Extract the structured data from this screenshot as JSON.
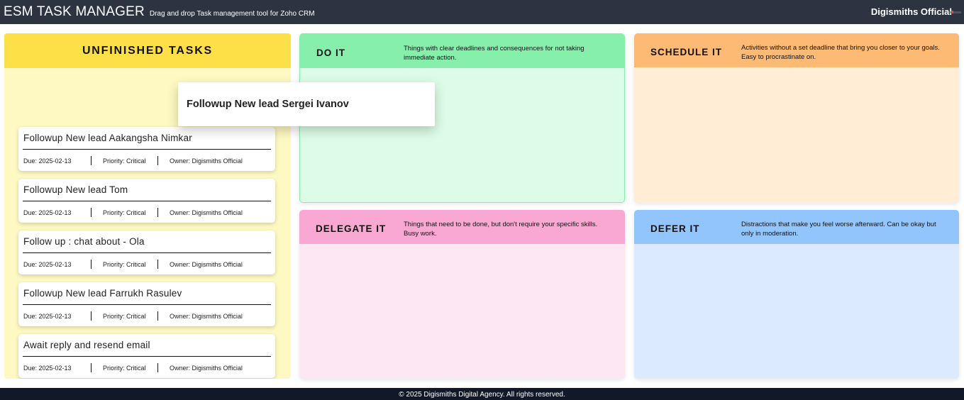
{
  "header": {
    "app_title": "ESM TASK MANAGER",
    "app_subtitle": "Drag and drop Task management tool for Zoho CRM",
    "user_name": "Digismiths Official"
  },
  "unfinished": {
    "title": "UNFINISHED TASKS",
    "tasks": [
      {
        "title": "Followup New lead Aakangsha Nimkar",
        "due": "Due: 2025-02-13",
        "priority": "Priority: Critical",
        "owner": "Owner: Digismiths Official"
      },
      {
        "title": "Followup New lead Tom",
        "due": "Due: 2025-02-13",
        "priority": "Priority: Critical",
        "owner": "Owner: Digismiths Official"
      },
      {
        "title": "Follow up : chat about - Ola",
        "due": "Due: 2025-02-13",
        "priority": "Priority: Critical",
        "owner": "Owner: Digismiths Official"
      },
      {
        "title": "Followup New lead Farrukh Rasulev",
        "due": "Due: 2025-02-13",
        "priority": "Priority: Critical",
        "owner": "Owner: Digismiths Official"
      },
      {
        "title": "Await reply and resend email",
        "due": "Due: 2025-02-13",
        "priority": "Priority: Critical",
        "owner": "Owner: Digismiths Official"
      }
    ]
  },
  "dragging_task": {
    "title": "Followup New lead Sergei Ivanov"
  },
  "quadrants": {
    "do_it": {
      "title": "DO IT",
      "description": "Things with clear deadlines and consequences for not taking immediate action."
    },
    "schedule_it": {
      "title": "SCHEDULE IT",
      "description": "Activities without a set deadline that bring you closer to your goals. Easy to procrastinate on."
    },
    "delegate_it": {
      "title": "DELEGATE IT",
      "description": "Things that need to be done, but don't require your specific skills. Busy work."
    },
    "defer_it": {
      "title": "DEFER IT",
      "description": "Distractions that make you feel worse afterward. Can be okay but only in moderation."
    }
  },
  "footer": {
    "text": "© 2025 Digismiths Digital Agency. All rights reserved."
  },
  "colors": {
    "topbar": "#2d3441",
    "unfinished_header": "#fde047",
    "do_it": "#86efac",
    "schedule_it": "#fdba74",
    "delegate_it": "#f9a8d4",
    "defer_it": "#93c5fd"
  }
}
